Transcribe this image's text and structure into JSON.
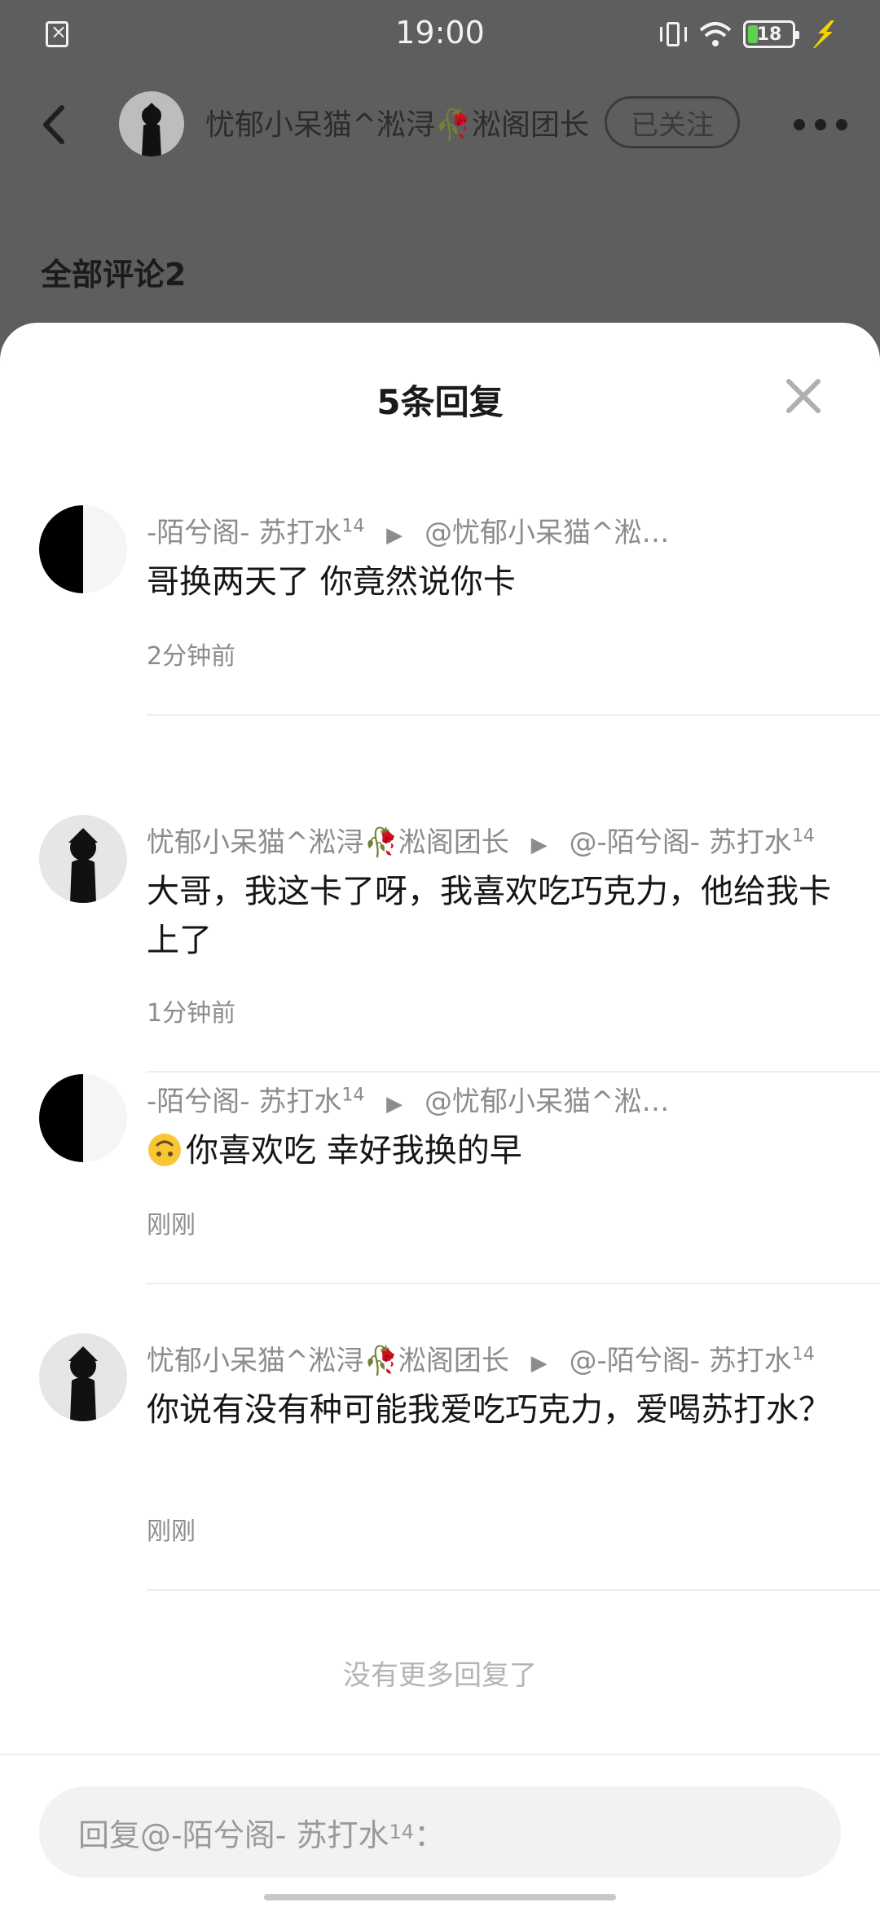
{
  "status_bar": {
    "time": "19:00",
    "battery": "18",
    "icons": [
      "sim-error-icon",
      "vibrate-icon",
      "wifi-icon",
      "battery-icon",
      "charging-icon"
    ]
  },
  "header": {
    "user_name": "忧郁小呆猫^淞浔🥀淞阁团长",
    "follow_label": "已关注",
    "all_comments_label": "全部评论2"
  },
  "sheet": {
    "title": "5条回复",
    "no_more": "没有更多回复了",
    "input_placeholder_prefix": "回复@-陌兮阁- 苏打水",
    "input_placeholder_sup": "14",
    "input_placeholder_suffix": "："
  },
  "replies": [
    {
      "author": "-陌兮阁- 苏打水",
      "author_sup": "14",
      "target": "@忧郁小呆猫^淞…",
      "target_sup": "",
      "content": "哥换两天了 你竟然说你卡",
      "time": "2分钟前"
    },
    {
      "author": "忧郁小呆猫^淞浔🥀淞阁团长",
      "author_sup": "",
      "target": "@-陌兮阁- 苏打水",
      "target_sup": "14",
      "content": "大哥，我这卡了呀，我喜欢吃巧克力，他给我卡上了",
      "time": "1分钟前"
    },
    {
      "author": "-陌兮阁- 苏打水",
      "author_sup": "14",
      "target": "@忧郁小呆猫^淞…",
      "target_sup": "",
      "content": "你喜欢吃 幸好我换的早",
      "time": "刚刚"
    },
    {
      "author": "忧郁小呆猫^淞浔🥀淞阁团长",
      "author_sup": "",
      "target": "@-陌兮阁- 苏打水",
      "target_sup": "14",
      "content": "你说有没有种可能我爱吃巧克力，爱喝苏打水？",
      "time": "刚刚"
    }
  ]
}
